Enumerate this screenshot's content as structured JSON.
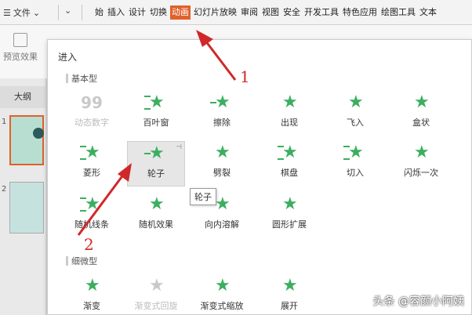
{
  "menubar": {
    "file_label": "文件",
    "tabs": [
      "始",
      "插入",
      "设计",
      "切换",
      "动画",
      "幻灯片放映",
      "审阅",
      "视图",
      "安全",
      "开发工具",
      "特色应用",
      "绘图工具",
      "文本"
    ],
    "active_tab": "动画"
  },
  "ribbon": {
    "preview_label": "预览效果"
  },
  "left_panel": {
    "outline_label": "大纲",
    "slide_numbers": [
      "1",
      "2"
    ]
  },
  "dropdown": {
    "header": "进入",
    "sections": [
      {
        "title": "基本型",
        "effects": [
          {
            "label": "动态数字",
            "disabled": true,
            "icon": "digits-icon",
            "glyph": "99"
          },
          {
            "label": "百叶窗",
            "icon": "star-icon"
          },
          {
            "label": "擦除",
            "icon": "star-icon"
          },
          {
            "label": "出现",
            "icon": "star-icon"
          },
          {
            "label": "飞入",
            "icon": "star-icon"
          },
          {
            "label": "盒状",
            "icon": "star-icon"
          },
          {
            "label": "菱形",
            "icon": "star-icon"
          },
          {
            "label": "轮子",
            "icon": "star-icon",
            "hovered": true
          },
          {
            "label": "劈裂",
            "icon": "star-icon"
          },
          {
            "label": "棋盘",
            "icon": "star-icon"
          },
          {
            "label": "切入",
            "icon": "star-icon"
          },
          {
            "label": "闪烁一次",
            "icon": "star-icon"
          },
          {
            "label": "随机线条",
            "icon": "star-icon"
          },
          {
            "label": "随机效果",
            "icon": "star-icon"
          },
          {
            "label": "向内溶解",
            "icon": "star-icon"
          },
          {
            "label": "圆形扩展",
            "icon": "star-icon"
          }
        ]
      },
      {
        "title": "细微型",
        "effects": [
          {
            "label": "渐变",
            "icon": "star-icon"
          },
          {
            "label": "渐变式回旋",
            "disabled": true,
            "icon": "star-icon"
          },
          {
            "label": "渐变式缩放",
            "icon": "star-icon"
          },
          {
            "label": "展开",
            "icon": "star-icon"
          }
        ]
      }
    ],
    "tooltip": "轮子"
  },
  "annotations": {
    "label_1": "1",
    "label_2": "2",
    "color": "#d0282a"
  },
  "watermark": "头条 @容颜小阿姨",
  "colors": {
    "accent": "#e0612a",
    "star_green": "#3cae5f"
  }
}
